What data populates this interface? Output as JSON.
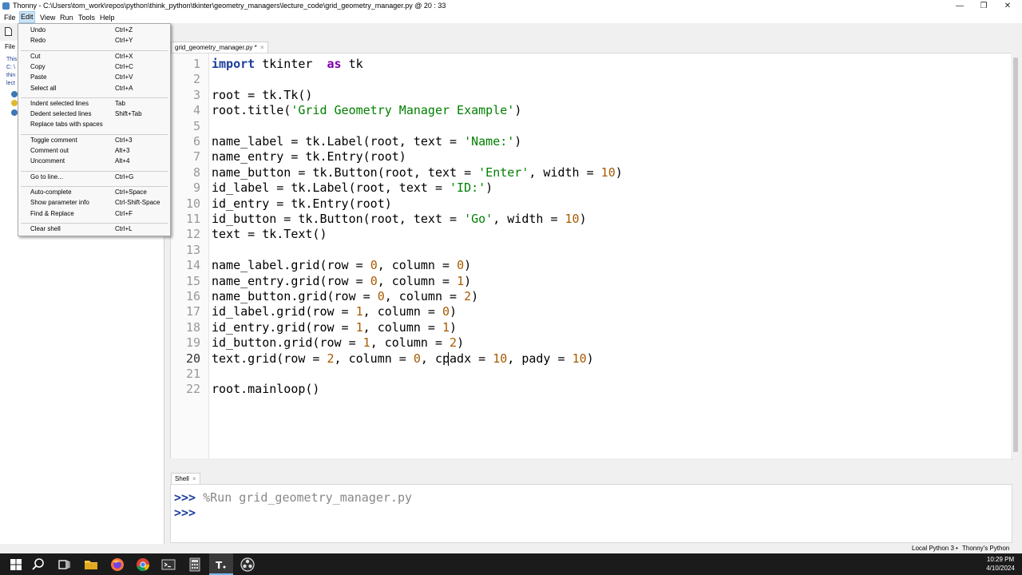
{
  "window": {
    "title": "Thonny  -  C:\\Users\\tom_work\\repos\\python\\think_python\\tkinter\\geometry_managers\\lecture_code\\grid_geometry_manager.py  @  20 : 33",
    "minimize": "—",
    "maximize": "❐",
    "close": "✕"
  },
  "menubar": [
    "File",
    "Edit",
    "View",
    "Run",
    "Tools",
    "Help"
  ],
  "edit_menu": {
    "groups": [
      [
        {
          "label": "Undo",
          "shortcut": "Ctrl+Z"
        },
        {
          "label": "Redo",
          "shortcut": "Ctrl+Y"
        }
      ],
      [
        {
          "label": "Cut",
          "shortcut": "Ctrl+X"
        },
        {
          "label": "Copy",
          "shortcut": "Ctrl+C"
        },
        {
          "label": "Paste",
          "shortcut": "Ctrl+V"
        },
        {
          "label": "Select all",
          "shortcut": "Ctrl+A"
        }
      ],
      [
        {
          "label": "Indent selected lines",
          "shortcut": "Tab"
        },
        {
          "label": "Dedent selected lines",
          "shortcut": "Shift+Tab"
        },
        {
          "label": "Replace tabs with spaces",
          "shortcut": ""
        }
      ],
      [
        {
          "label": "Toggle comment",
          "shortcut": "Ctrl+3"
        },
        {
          "label": "Comment out",
          "shortcut": "Alt+3"
        },
        {
          "label": "Uncomment",
          "shortcut": "Alt+4"
        }
      ],
      [
        {
          "label": "Go to line...",
          "shortcut": "Ctrl+G"
        }
      ],
      [
        {
          "label": "Auto-complete",
          "shortcut": "Ctrl+Space"
        },
        {
          "label": "Show parameter info",
          "shortcut": "Ctrl-Shift-Space"
        },
        {
          "label": "Find & Replace",
          "shortcut": "Ctrl+F"
        }
      ],
      [
        {
          "label": "Clear shell",
          "shortcut": "Ctrl+L"
        }
      ]
    ]
  },
  "files_pane": {
    "tab": "File",
    "path_lines": [
      "This",
      "C: \\",
      "thin",
      "lect"
    ]
  },
  "editor": {
    "tab_label": "grid_geometry_manager.py *",
    "tab_close": "×",
    "current_line": 20,
    "lines": [
      [
        [
          "kw",
          "import"
        ],
        [
          "",
          "tkinter "
        ],
        [
          "kw",
          "as"
        ],
        [
          "",
          ""
        ],
        [
          "",
          "tk"
        ]
      ],
      [],
      [
        [
          "",
          "root = tk.Tk()"
        ]
      ],
      [
        [
          "",
          "root.title("
        ],
        [
          "str",
          "'Grid Geometry Manager Example'"
        ],
        [
          "",
          ")"
        ]
      ],
      [],
      [
        [
          "",
          "name_label = tk.Label(root, text = "
        ],
        [
          "str",
          "'Name:'"
        ],
        [
          "",
          ")"
        ]
      ],
      [
        [
          "",
          "name_entry = tk.Entry(root)"
        ]
      ],
      [
        [
          "",
          "name_button = tk.Button(root, text = "
        ],
        [
          "str",
          "'Enter'"
        ],
        [
          "",
          ", width = "
        ],
        [
          "num",
          "10"
        ],
        [
          "",
          ")"
        ]
      ],
      [
        [
          "",
          "id_label = tk.Label(root, text = "
        ],
        [
          "str",
          "'ID:'"
        ],
        [
          "",
          ")"
        ]
      ],
      [
        [
          "",
          "id_entry = tk.Entry(root)"
        ]
      ],
      [
        [
          "",
          "id_button = tk.Button(root, text = "
        ],
        [
          "str",
          "'Go'"
        ],
        [
          "",
          ", width = "
        ],
        [
          "num",
          "10"
        ],
        [
          "",
          ")"
        ]
      ],
      [
        [
          "",
          "text = tk.Text()"
        ]
      ],
      [],
      [
        [
          "",
          "name_label.grid(row = "
        ],
        [
          "num",
          "0"
        ],
        [
          "",
          ", column = "
        ],
        [
          "num",
          "0"
        ],
        [
          "",
          ")"
        ]
      ],
      [
        [
          "",
          "name_entry.grid(row = "
        ],
        [
          "num",
          "0"
        ],
        [
          "",
          ", column = "
        ],
        [
          "num",
          "1"
        ],
        [
          "",
          ")"
        ]
      ],
      [
        [
          "",
          "name_button.grid(row = "
        ],
        [
          "num",
          "0"
        ],
        [
          "",
          ", column = "
        ],
        [
          "num",
          "2"
        ],
        [
          "",
          ")"
        ]
      ],
      [
        [
          "",
          "id_label.grid(row = "
        ],
        [
          "num",
          "1"
        ],
        [
          "",
          ", column = "
        ],
        [
          "num",
          "0"
        ],
        [
          "",
          ")"
        ]
      ],
      [
        [
          "",
          "id_entry.grid(row = "
        ],
        [
          "num",
          "1"
        ],
        [
          "",
          ", column = "
        ],
        [
          "num",
          "1"
        ],
        [
          "",
          ")"
        ]
      ],
      [
        [
          "",
          "id_button.grid(row = "
        ],
        [
          "num",
          "1"
        ],
        [
          "",
          ", column = "
        ],
        [
          "num",
          "2"
        ],
        [
          "",
          ")"
        ]
      ],
      [
        [
          "",
          "text.grid(row = "
        ],
        [
          "num",
          "2"
        ],
        [
          "",
          ", column = "
        ],
        [
          "num",
          "0"
        ],
        [
          "",
          ", cpadx = "
        ],
        [
          "num",
          "10"
        ],
        [
          "",
          ", pady = "
        ],
        [
          "num",
          "10"
        ],
        [
          "",
          ")"
        ]
      ],
      [],
      [
        [
          "",
          "root.mainloop()"
        ]
      ]
    ]
  },
  "shell": {
    "tab_label": "Shell",
    "tab_close": "×",
    "prompt": ">>>",
    "run_command": "%Run grid_geometry_manager.py"
  },
  "statusbar": {
    "interpreter": "Local Python 3",
    "sep": "•",
    "interpreter_name": "Thonny's Python"
  },
  "taskbar": {
    "time": "10:29 PM",
    "date": "4/10/2024",
    "icons": [
      "windows-start-icon",
      "search-icon",
      "task-view-icon",
      "file-explorer-icon",
      "firefox-icon",
      "chrome-icon",
      "terminal-icon",
      "calculator-icon",
      "thonny-icon",
      "obs-icon"
    ]
  }
}
